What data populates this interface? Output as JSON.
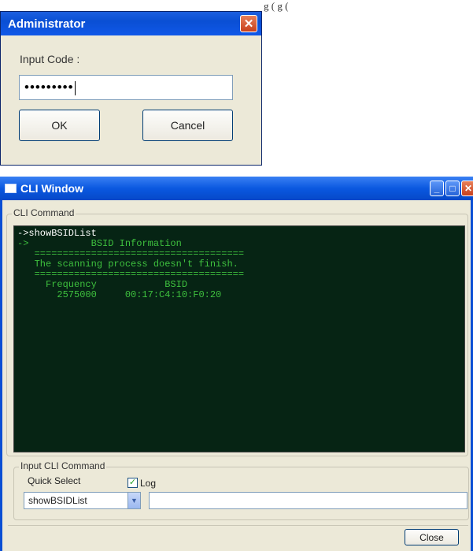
{
  "top_fragment": "g         (  g         (",
  "admin_dialog": {
    "title": "Administrator",
    "close_glyph": "✕",
    "input_label": "Input Code :",
    "code_value": "•••••••••",
    "ok_label": "OK",
    "cancel_label": "Cancel",
    "colors": {
      "titlebar": "#0a4fd4",
      "close": "#c8401c"
    }
  },
  "cli_window": {
    "title": "CLI Window",
    "minimize_glyph": "_",
    "maximize_glyph": "□",
    "close_glyph": "✕",
    "command_group_label": "CLI Command",
    "terminal_lines": [
      "->showBSIDList",
      "->           BSID Information",
      "   =====================================",
      "   The scanning process doesn't finish.",
      "   =====================================",
      "     Frequency            BSID",
      "       2575000     00:17:C4:10:F0:20"
    ],
    "input_group_label": "Input CLI  Command",
    "quick_select_label": "Quick Select",
    "log_checked_glyph": "✓",
    "log_label": "Log",
    "quick_select_value": "showBSIDList",
    "select_arrow_glyph": "▼",
    "command_input_value": "",
    "close_button_label": "Close",
    "colors": {
      "terminal_bg": "#062414",
      "terminal_text": "#3ec03e"
    }
  }
}
